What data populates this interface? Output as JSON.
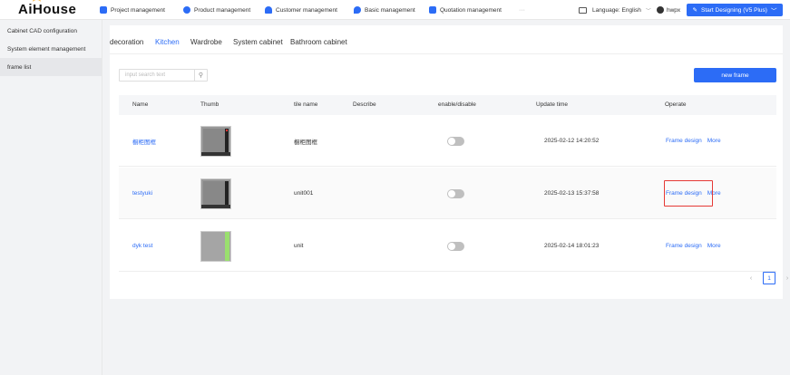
{
  "app": {
    "logo": "AiHouse"
  },
  "nav": [
    {
      "label": "Project management",
      "color": "#2c6cf6"
    },
    {
      "label": "Product management",
      "color": "#2c6cf6"
    },
    {
      "label": "Customer management",
      "color": "#2c6cf6"
    },
    {
      "label": "Basic management",
      "color": "#2c6cf6"
    },
    {
      "label": "Quotation management",
      "color": "#2c6cf6"
    }
  ],
  "nav_more": "···",
  "language": {
    "label": "Language: English"
  },
  "user": {
    "name": "hwpx"
  },
  "start_button": "Start Designing (V5 Plus)",
  "sidebar": {
    "items": [
      {
        "label": "Cabinet CAD configuration"
      },
      {
        "label": "System element management"
      },
      {
        "label": "frame list"
      }
    ]
  },
  "tabs": [
    "decoration",
    "Kitchen",
    "Wardrobe",
    "System cabinet",
    "Bathroom cabinet"
  ],
  "active_tab": "Kitchen",
  "search": {
    "placeholder": "input search text"
  },
  "new_frame_label": "new frame",
  "table": {
    "columns": [
      "Name",
      "Thumb",
      "tile name",
      "Describe",
      "enable/disable",
      "Update time",
      "Operate"
    ],
    "rows": [
      {
        "name": "橱柜图框",
        "tile_name": "橱柜图框",
        "describe": "",
        "enabled": false,
        "update_time": "2025-02-12 14:20:52",
        "op_design": "Frame design",
        "op_more": "More"
      },
      {
        "name": "testyuki",
        "tile_name": "unit001",
        "describe": "",
        "enabled": false,
        "update_time": "2025-02-13 15:37:58",
        "op_design": "Frame design",
        "op_more": "More"
      },
      {
        "name": "dyk test",
        "tile_name": "unit",
        "describe": "",
        "enabled": false,
        "update_time": "2025-02-14 18:01:23",
        "op_design": "Frame design",
        "op_more": "More"
      }
    ]
  },
  "pagination": {
    "current": "1",
    "prev": "‹",
    "next": "›"
  },
  "colors": {
    "accent": "#2c6cf6",
    "highlight": "#e53935"
  }
}
